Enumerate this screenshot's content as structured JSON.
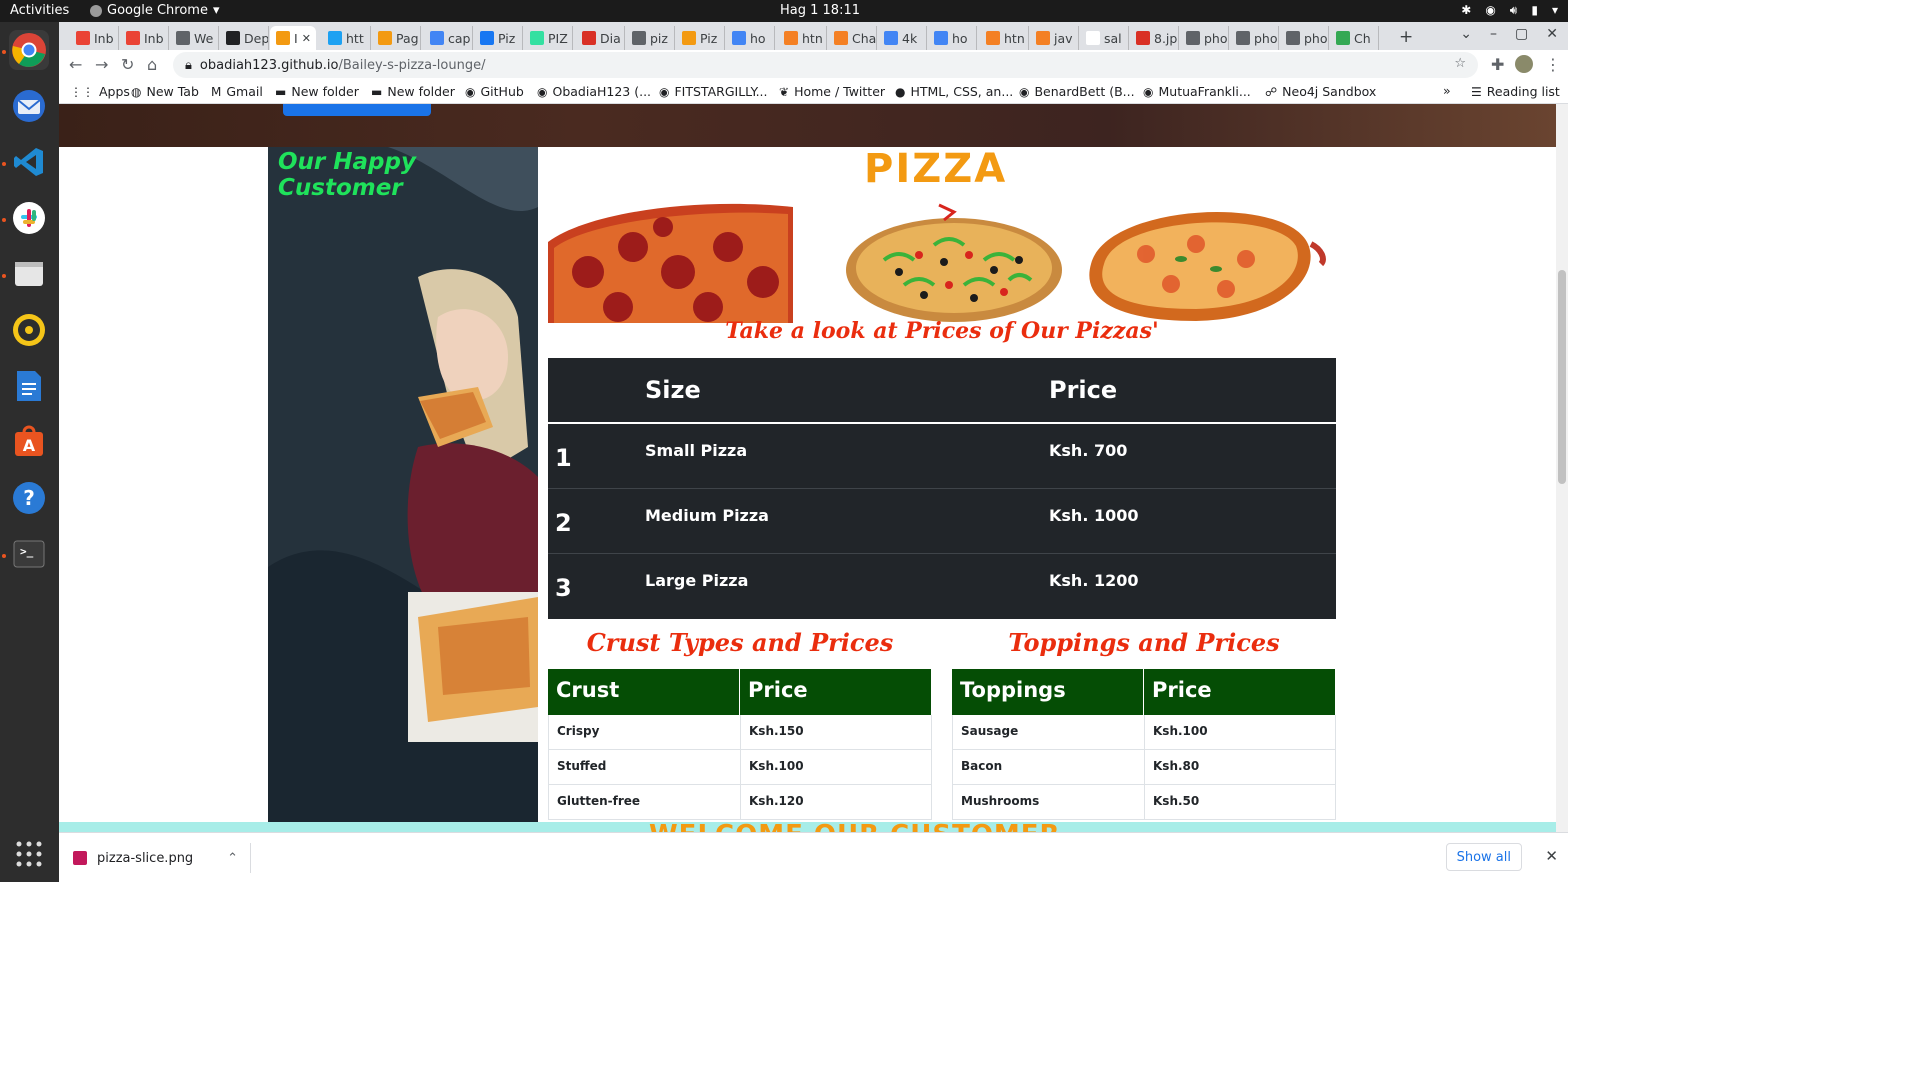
{
  "system": {
    "activities": "Activities",
    "app_name": "Google Chrome",
    "clock": "Hag 1  18:11"
  },
  "tabs": [
    {
      "label": "Inb",
      "icon": "gmail-icon",
      "color": "#ea4335"
    },
    {
      "label": "Inb",
      "icon": "gmail-icon",
      "color": "#ea4335"
    },
    {
      "label": "We",
      "icon": "pin-icon",
      "color": "#5f6368"
    },
    {
      "label": "Dep",
      "icon": "github-icon",
      "color": "#202124"
    },
    {
      "label": "I",
      "icon": "pizza-icon",
      "color": "#f39a12"
    },
    {
      "label": "htt",
      "icon": "twitter-icon",
      "color": "#1da1f2"
    },
    {
      "label": "Pag",
      "icon": "pizza-icon",
      "color": "#f39a12"
    },
    {
      "label": "cap",
      "icon": "google-icon",
      "color": "#4285f4"
    },
    {
      "label": "Piz",
      "icon": "facebook-icon",
      "color": "#1877f2"
    },
    {
      "label": "PIZ",
      "icon": "tripadvisor-icon",
      "color": "#34e0a1"
    },
    {
      "label": "Dia",
      "icon": "diagram-icon",
      "color": "#d93025"
    },
    {
      "label": "piz",
      "icon": "globe-icon",
      "color": "#5f6368"
    },
    {
      "label": "Piz",
      "icon": "pizza-icon",
      "color": "#f39a12"
    },
    {
      "label": "ho",
      "icon": "google-icon",
      "color": "#4285f4"
    },
    {
      "label": "htn",
      "icon": "stackoverflow-icon",
      "color": "#f48024"
    },
    {
      "label": "Cha",
      "icon": "stackoverflow-icon",
      "color": "#f48024"
    },
    {
      "label": "4k",
      "icon": "google-icon",
      "color": "#4285f4"
    },
    {
      "label": "ho",
      "icon": "google-icon",
      "color": "#4285f4"
    },
    {
      "label": "htn",
      "icon": "stackoverflow-icon",
      "color": "#f48024"
    },
    {
      "label": "jav",
      "icon": "stackoverflow-icon",
      "color": "#f48024"
    },
    {
      "label": "sal",
      "icon": "blank-icon",
      "color": "#ffffff"
    },
    {
      "label": "8.jp",
      "icon": "image-icon",
      "color": "#d93025"
    },
    {
      "label": "pho",
      "icon": "globe-icon",
      "color": "#5f6368"
    },
    {
      "label": "pho",
      "icon": "globe-icon",
      "color": "#5f6368"
    },
    {
      "label": "pho",
      "icon": "globe-icon",
      "color": "#5f6368"
    },
    {
      "label": "Ch",
      "icon": "chrome-web-store-icon",
      "color": "#34a853"
    }
  ],
  "address": {
    "domain": "obadiah123.github.io",
    "path": "/Bailey-s-pizza-lounge/"
  },
  "bookmarks": [
    {
      "label": "Apps",
      "icon": "apps-grid-icon"
    },
    {
      "label": "New Tab",
      "icon": "globe-icon"
    },
    {
      "label": "Gmail",
      "icon": "gmail-icon"
    },
    {
      "label": "New folder",
      "icon": "folder-icon"
    },
    {
      "label": "New folder",
      "icon": "folder-icon"
    },
    {
      "label": "GitHub",
      "icon": "github-icon"
    },
    {
      "label": "ObadiaH123 (...",
      "icon": "github-icon"
    },
    {
      "label": "FITSTARGILLY...",
      "icon": "github-icon"
    },
    {
      "label": "Home / Twitter",
      "icon": "twitter-icon"
    },
    {
      "label": "HTML, CSS, an...",
      "icon": "site-icon"
    },
    {
      "label": "BenardBett (B...",
      "icon": "github-icon"
    },
    {
      "label": "MutuaFrankli...",
      "icon": "github-icon"
    },
    {
      "label": "Neo4j Sandbox",
      "icon": "neo4j-icon"
    }
  ],
  "reading_list": "Reading list",
  "page": {
    "customer_title": "Our Happy Customer",
    "pizza_word": "PIZZA",
    "prices_heading": "Take a look at Prices of Our Pizzas'",
    "size_table": {
      "headers": {
        "size": "Size",
        "price": "Price"
      },
      "rows": [
        {
          "num": "1",
          "name": "Small Pizza",
          "price": "Ksh. 700"
        },
        {
          "num": "2",
          "name": "Medium Pizza",
          "price": "Ksh. 1000"
        },
        {
          "num": "3",
          "name": "Large Pizza",
          "price": "Ksh. 1200"
        }
      ]
    },
    "crust": {
      "heading": "Crust Types and Prices",
      "headers": {
        "name": "Crust",
        "price": "Price"
      },
      "rows": [
        {
          "name": "Crispy",
          "price": "Ksh.150"
        },
        {
          "name": "Stuffed",
          "price": "Ksh.100"
        },
        {
          "name": "Glutten-free",
          "price": "Ksh.120"
        }
      ]
    },
    "toppings": {
      "heading": "Toppings and Prices",
      "headers": {
        "name": "Toppings",
        "price": "Price"
      },
      "rows": [
        {
          "name": "Sausage",
          "price": "Ksh.100"
        },
        {
          "name": "Bacon",
          "price": "Ksh.80"
        },
        {
          "name": "Mushrooms",
          "price": "Ksh.50"
        }
      ]
    },
    "welcome_text": "WELCOME OUR CUSTOMER"
  },
  "download": {
    "filename": "pizza-slice.png",
    "show_all": "Show all"
  },
  "colors": {
    "heading_red": "#ea2d0e",
    "customer_green": "#1fe25b",
    "pizza_orange": "#f39a12",
    "dark_table": "#212529",
    "green_header": "#054d05"
  }
}
